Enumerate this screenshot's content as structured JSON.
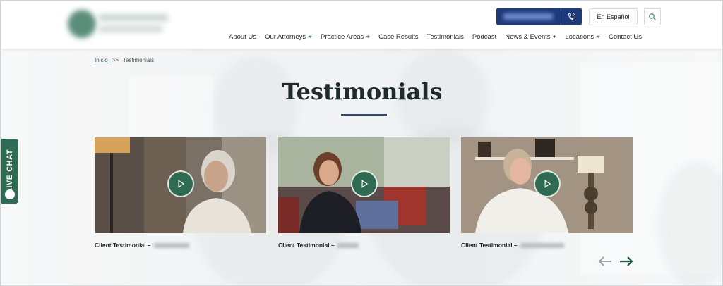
{
  "header": {
    "lang_button": "En Español",
    "nav": [
      {
        "label": "About Us",
        "plus": ""
      },
      {
        "label": "Our Attorneys",
        "plus": "+"
      },
      {
        "label": "Practice Areas",
        "plus": "+"
      },
      {
        "label": "Case Results",
        "plus": ""
      },
      {
        "label": "Testimonials",
        "plus": ""
      },
      {
        "label": "Podcast",
        "plus": ""
      },
      {
        "label": "News & Events",
        "plus": "+"
      },
      {
        "label": "Locations",
        "plus": "+"
      },
      {
        "label": "Contact Us",
        "plus": ""
      }
    ]
  },
  "breadcrumb": {
    "home": "Inicio",
    "separator": ">>",
    "current": "Testimonials"
  },
  "page": {
    "title": "Testimonials"
  },
  "cards": [
    {
      "caption": "Client Testimonial –"
    },
    {
      "caption": "Client Testimonial –"
    },
    {
      "caption": "Client Testimonial –"
    }
  ],
  "live_chat": {
    "label": "LIVE CHAT"
  },
  "icons": {
    "phone": "phone-icon",
    "search": "search-icon",
    "play": "play-icon",
    "prev": "arrow-left-icon",
    "next": "arrow-right-icon",
    "chat": "chat-bubble-icon"
  },
  "colors": {
    "brand_green": "#2f6b52",
    "brand_blue": "#1f3a7a"
  }
}
